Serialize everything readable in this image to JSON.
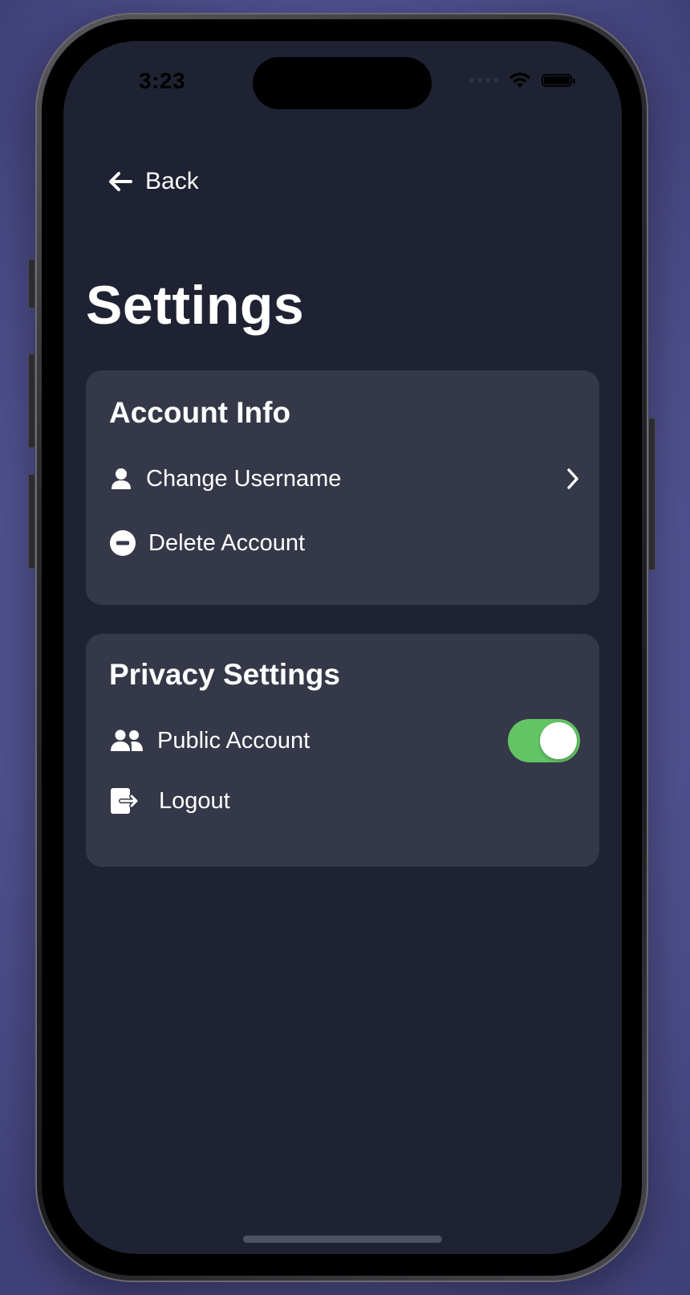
{
  "status_bar": {
    "time": "3:23"
  },
  "nav": {
    "back_label": "Back"
  },
  "page": {
    "title": "Settings"
  },
  "sections": [
    {
      "title": "Account Info",
      "items": [
        {
          "label": "Change Username",
          "icon": "person-icon",
          "accessory": "chevron-right-icon"
        },
        {
          "label": "Delete Account",
          "icon": "minus-circle-icon"
        }
      ]
    },
    {
      "title": "Privacy Settings",
      "items": [
        {
          "label": "Public Account",
          "icon": "people-icon",
          "toggle": true,
          "toggle_on": true
        },
        {
          "label": "Logout",
          "icon": "logout-icon"
        }
      ]
    }
  ],
  "colors": {
    "background": "#1f2232",
    "card": "#353848",
    "toggle_on": "#62c464",
    "text": "#ffffff",
    "backdrop": "#5b5b9f"
  }
}
